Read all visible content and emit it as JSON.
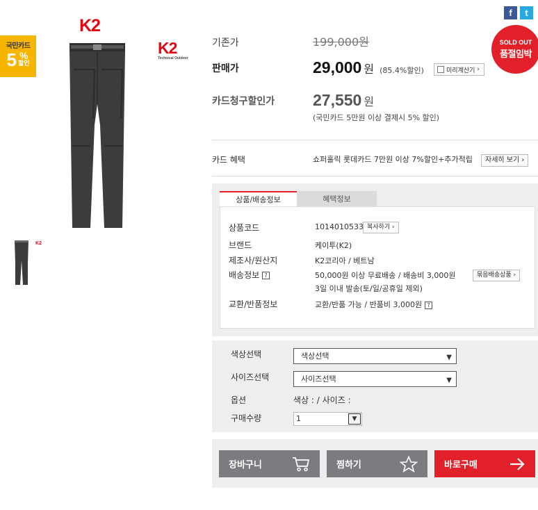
{
  "social": {
    "facebook": "f",
    "twitter": "t"
  },
  "brand_logo": "K2",
  "brand_logo_sub": "Technical Outdoor",
  "card_badge": {
    "line1": "국민카드",
    "percent": "5",
    "percent_sign": "%",
    "line2": "할인"
  },
  "sold_out": {
    "line1": "SOLD OUT",
    "line2": "품절임박"
  },
  "price": {
    "original_label": "기존가",
    "original_value": "199,000원",
    "sale_label": "판매가",
    "sale_amount": "29,000",
    "won": "원",
    "discount_rate": "(85.4%할인)",
    "calc_button": "미리계산기",
    "card_label": "카드청구할인가",
    "card_amount": "27,550",
    "card_note": "(국민카드 5만원 이상 결제시 5% 할인)"
  },
  "benefit": {
    "label": "카드 혜택",
    "text": "쇼퍼홀릭 롯데카드 7만원 이상 7%할인+추가적립",
    "button": "자세히 보기"
  },
  "tabs": [
    {
      "label": "상품/배송정보",
      "active": true
    },
    {
      "label": "혜택정보",
      "active": false
    }
  ],
  "info": {
    "code_label": "상품코드",
    "code_value": "1014010533",
    "copy_button": "복사하기",
    "brand_label": "브랜드",
    "brand_value": "케이투(K2)",
    "maker_label": "제조사/원산지",
    "maker_value": "K2코리아 / 베트남",
    "ship_label": "배송정보",
    "ship_value1": "50,000원 이상 무료배송 / 배송비 3,000원",
    "ship_value2": "3일 이내 발송(토/일/공휴일 제외)",
    "bundle_button": "묶음배송상품",
    "return_label": "교환/반품정보",
    "return_value": "교환/반품 가능 / 반품비 3,000원"
  },
  "options": {
    "color_label": "색상선택",
    "color_value": "색상선택",
    "size_label": "사이즈선택",
    "size_value": "사이즈선택",
    "option_label": "옵션",
    "option_value": "색상 : / 사이즈 :",
    "qty_label": "구매수량",
    "qty_value": "1"
  },
  "actions": {
    "cart": "장바구니",
    "wish": "찜하기",
    "buy": "바로구매"
  },
  "colors": {
    "accent_red": "#e2202a",
    "badge_yellow": "#f7b500",
    "button_gray": "#7a7c80"
  }
}
